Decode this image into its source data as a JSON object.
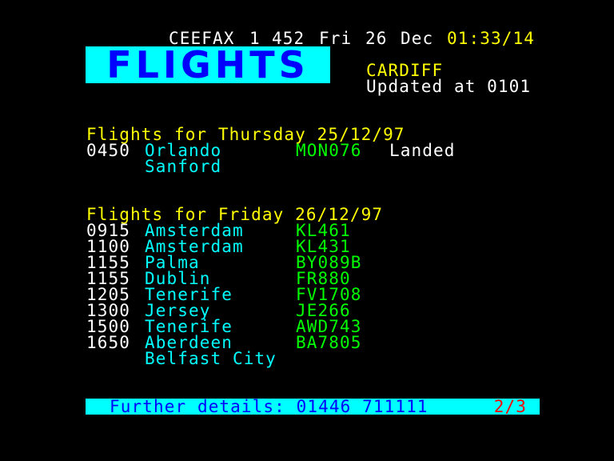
{
  "header": {
    "service": "CEEFAX",
    "channel": "1",
    "page": "452",
    "day": "Fri",
    "date": "26",
    "month": "Dec",
    "time": "01:33/14"
  },
  "logo": {
    "title": "FLIGHTS"
  },
  "location": {
    "city": "CARDIFF",
    "updated": "Updated at 0101"
  },
  "sections": [
    {
      "heading": "Flights for Thursday 25/12/97",
      "rows": [
        {
          "time": "0450",
          "destination": "Orlando",
          "destination_line2": "Sanford",
          "flight": "MON076",
          "status": "Landed"
        }
      ]
    },
    {
      "heading": "Flights for Friday 26/12/97",
      "rows": [
        {
          "time": "0915",
          "destination": "Amsterdam",
          "flight": "KL461"
        },
        {
          "time": "1100",
          "destination": "Amsterdam",
          "flight": "KL431"
        },
        {
          "time": "1155",
          "destination": "Palma",
          "flight": "BY089B"
        },
        {
          "time": "1155",
          "destination": "Dublin",
          "flight": "FR880"
        },
        {
          "time": "1205",
          "destination": "Tenerife",
          "flight": "FV1708"
        },
        {
          "time": "1300",
          "destination": "Jersey",
          "flight": "JE266"
        },
        {
          "time": "1500",
          "destination": "Tenerife",
          "flight": "AWD743"
        },
        {
          "time": "1650",
          "destination": "Aberdeen",
          "destination_line2": "Belfast City",
          "flight": "BA7805"
        }
      ]
    }
  ],
  "footer": {
    "details": "Further details: 01446 711111",
    "page_indicator": "2/3"
  },
  "colors": {
    "background": "#000000",
    "heading": "#ffff00",
    "time": "#ffffff",
    "destination": "#00ffff",
    "flight": "#00ff00",
    "logo_bg": "#00ffff",
    "logo_fg": "#0000ff",
    "footer_bg": "#00ffff",
    "footer_fg": "#0000ff",
    "page_indicator": "#ff0000"
  }
}
